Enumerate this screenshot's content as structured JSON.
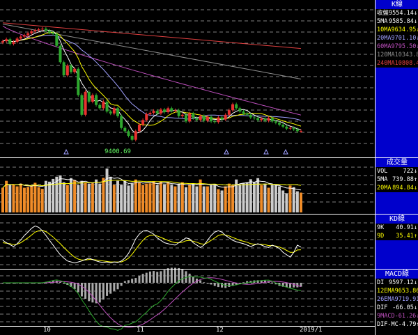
{
  "colors": {
    "up": "#e8312f",
    "down": "#2ea82e",
    "ma5": "#ffffff",
    "ma10": "#ffff00",
    "ma20": "#a0a0ff",
    "ma60": "#c050c0",
    "ma120": "#909090",
    "ma240": "#e04040",
    "vol_up": "#f08c28",
    "vol_down": "#cccccc",
    "panel": "#0000cc"
  },
  "k_panel": {
    "title": "K線",
    "rows": [
      {
        "label": "收盤",
        "value": "9554.14",
        "arrow": "↓",
        "color": "#ffffff"
      },
      {
        "label": "5MA",
        "value": "9585.84",
        "arrow": "↓",
        "color": "#ffffff"
      },
      {
        "label": "10MA",
        "value": "9634.95",
        "arrow": "↓",
        "color": "#ffff00"
      },
      {
        "label": "20MA",
        "value": "9701.10",
        "arrow": "↓",
        "color": "#a0a0ff"
      },
      {
        "label": "60MA",
        "value": "9795.50",
        "arrow": "↓",
        "color": "#c050c0"
      },
      {
        "label": "120MA",
        "value": "10343.81",
        "arrow": "↓",
        "color": "#909090"
      },
      {
        "label": "240MA",
        "value": "10808.43",
        "arrow": "↓",
        "color": "#e04040"
      }
    ]
  },
  "vol_panel": {
    "title": "成交量",
    "rows": [
      {
        "label": "VOL",
        "value": "722",
        "arrow": "↓",
        "color": "#ffffff"
      },
      {
        "label": "5MA",
        "value": "739.88",
        "arrow": "↑",
        "color": "#ffffff"
      },
      {
        "label": "20MA",
        "value": "894.84",
        "arrow": "↓",
        "color": "#ffff00"
      }
    ]
  },
  "kd_panel": {
    "title": "KD線",
    "rows": [
      {
        "label": "9K",
        "value": "40.91",
        "arrow": "↓",
        "color": "#ffffff"
      },
      {
        "label": "9D",
        "value": "35.41",
        "arrow": "↑",
        "color": "#ffff00"
      }
    ]
  },
  "macd_panel": {
    "title": "MACD線",
    "rows": [
      {
        "label": "DI",
        "value": "9597.12",
        "arrow": "↓",
        "color": "#ffffff"
      },
      {
        "label": "12EMA",
        "value": "9653.86",
        "arrow": "↓",
        "color": "#ffff00"
      },
      {
        "label": "26EMA",
        "value": "9719.91",
        "arrow": "↓",
        "color": "#a0a0ff"
      },
      {
        "label": "DIF",
        "value": "-66.05",
        "arrow": "↓",
        "color": "#ffffff"
      },
      {
        "label": "9MACD",
        "value": "-61.26",
        "arrow": "↓",
        "color": "#c050c0"
      },
      {
        "label": "DIF-MC",
        "value": "-4.79",
        "arrow": "↑",
        "color": "#ffffff"
      }
    ]
  },
  "low_annotation": "9400.69",
  "x_labels": [
    "10",
    "11",
    "12",
    "2019/1"
  ],
  "chart_data": {
    "type": "candlestick",
    "closes": [
      10920,
      10950,
      10880,
      10910,
      10960,
      10990,
      11010,
      11040,
      11070,
      11090,
      11100,
      11110,
      11080,
      11050,
      11030,
      10850,
      10600,
      10400,
      10550,
      10450,
      10500,
      10100,
      9800,
      10150,
      10000,
      10100,
      9950,
      9900,
      10000,
      9850,
      9820,
      9900,
      9780,
      9600,
      9550,
      9480,
      9420,
      9550,
      9650,
      9720,
      9810,
      9830,
      9860,
      9820,
      9880,
      9840,
      9900,
      9860,
      9870,
      9780,
      9800,
      9700,
      9820,
      9750,
      9720,
      9780,
      9710,
      9770,
      9700,
      9690,
      9760,
      9730,
      9800,
      9870,
      9960,
      9900,
      9850,
      9820,
      9800,
      9760,
      9750,
      9720,
      9740,
      9710,
      9750,
      9700,
      9680,
      9650,
      9620,
      9590,
      9600,
      9580,
      9550,
      9554
    ],
    "ma60_value": "9795.50",
    "ma120_value": "10343.81",
    "ma240_value": "10808.43",
    "volumes": [
      900,
      1150,
      1000,
      1020,
      950,
      1050,
      900,
      930,
      950,
      1080,
      920,
      860,
      1150,
      1120,
      1220,
      1300,
      1350,
      1100,
      1000,
      1250,
      1180,
      1000,
      1150,
      1100,
      1050,
      1060,
      1200,
      1050,
      1260,
      1600,
      1300,
      1000,
      1150,
      1000,
      1150,
      980,
      1050,
      1200,
      1100,
      1000,
      1050,
      1060,
      1140,
      1000,
      1120,
      1030,
      1100,
      1000,
      950,
      1050,
      1100,
      920,
      1000,
      1050,
      950,
      1200,
      950,
      950,
      990,
      1020,
      850,
      800,
      950,
      1050,
      1000,
      1200,
      1020,
      1070,
      1100,
      1210,
      1100,
      1250,
      1000,
      1050,
      900,
      1000,
      1000,
      950,
      800,
      700,
      980,
      920,
      770,
      722
    ],
    "k_values": [
      55,
      50,
      46,
      42,
      48,
      56,
      65,
      72,
      80,
      85,
      82,
      75,
      65,
      55,
      45,
      35,
      25,
      18,
      12,
      10,
      8,
      10,
      12,
      15,
      18,
      15,
      12,
      10,
      9,
      10,
      8,
      10,
      9,
      12,
      18,
      28,
      42,
      58,
      68,
      74,
      76,
      72,
      68,
      60,
      55,
      50,
      48,
      46,
      45,
      50,
      55,
      60,
      58,
      50,
      45,
      40,
      45,
      55,
      65,
      72,
      75,
      72,
      65,
      60,
      55,
      52,
      50,
      48,
      45,
      42,
      45,
      48,
      45,
      42,
      40,
      45,
      42,
      38,
      30,
      25,
      20,
      30,
      45,
      40.91
    ],
    "d_values": [
      50,
      49,
      48,
      46,
      47,
      50,
      55,
      60,
      66,
      72,
      75,
      76,
      73,
      68,
      62,
      55,
      48,
      40,
      33,
      26,
      20,
      16,
      14,
      14,
      15,
      15,
      14,
      13,
      12,
      11,
      10,
      10,
      10,
      10,
      13,
      18,
      26,
      36,
      46,
      55,
      62,
      65,
      66,
      64,
      61,
      58,
      55,
      52,
      50,
      50,
      51,
      54,
      55,
      53,
      51,
      48,
      47,
      50,
      55,
      60,
      65,
      67,
      66,
      64,
      61,
      58,
      55,
      53,
      51,
      48,
      47,
      47,
      47,
      46,
      44,
      44,
      43,
      41,
      38,
      34,
      30,
      30,
      35,
      35.41
    ]
  }
}
